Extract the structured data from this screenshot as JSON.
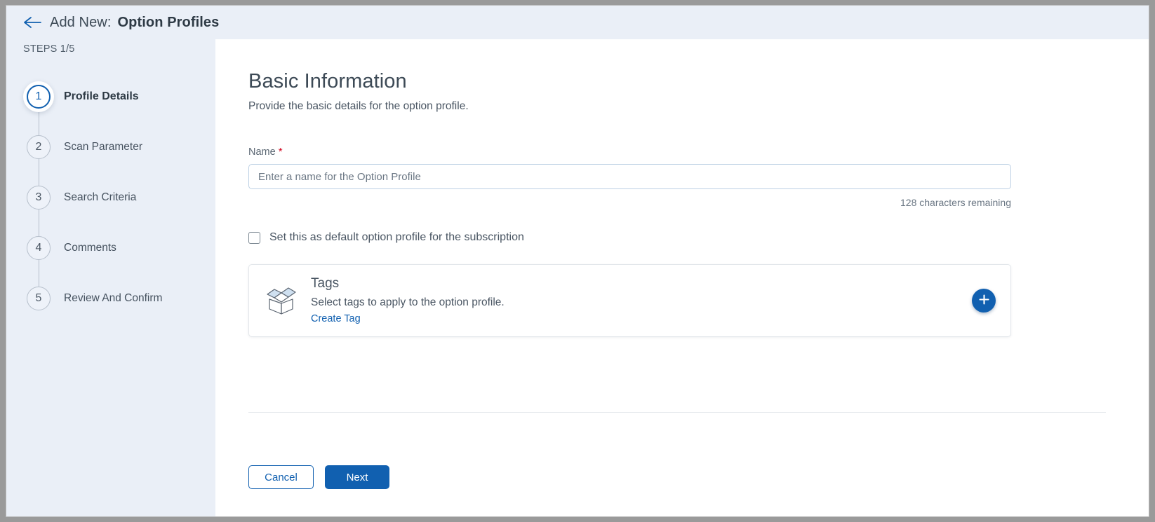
{
  "header": {
    "back_icon": "back-arrow-icon",
    "prefix": "Add New:",
    "title": "Option Profiles"
  },
  "sidebar": {
    "steps_label": "STEPS 1/5",
    "items": [
      {
        "number": "1",
        "label": "Profile Details",
        "active": true
      },
      {
        "number": "2",
        "label": "Scan Parameter",
        "active": false
      },
      {
        "number": "3",
        "label": "Search Criteria",
        "active": false
      },
      {
        "number": "4",
        "label": "Comments",
        "active": false
      },
      {
        "number": "5",
        "label": "Review And Confirm",
        "active": false
      }
    ]
  },
  "main": {
    "title": "Basic Information",
    "subtitle": "Provide the basic details for the option profile.",
    "name_field": {
      "label": "Name",
      "required_marker": "*",
      "placeholder": "Enter a name for the Option Profile",
      "value": "",
      "char_count": "128 characters remaining"
    },
    "default_checkbox": {
      "label": "Set this as default option profile for the subscription",
      "checked": false
    },
    "tags_card": {
      "icon": "open-box-icon",
      "title": "Tags",
      "description": "Select tags to apply to the option profile.",
      "link": "Create Tag",
      "add_icon": "plus-icon"
    }
  },
  "footer": {
    "cancel_label": "Cancel",
    "next_label": "Next"
  },
  "colors": {
    "accent": "#1160b0",
    "sidebar_bg": "#eaeff7",
    "required": "#d0021b",
    "text": "#4a5663"
  }
}
